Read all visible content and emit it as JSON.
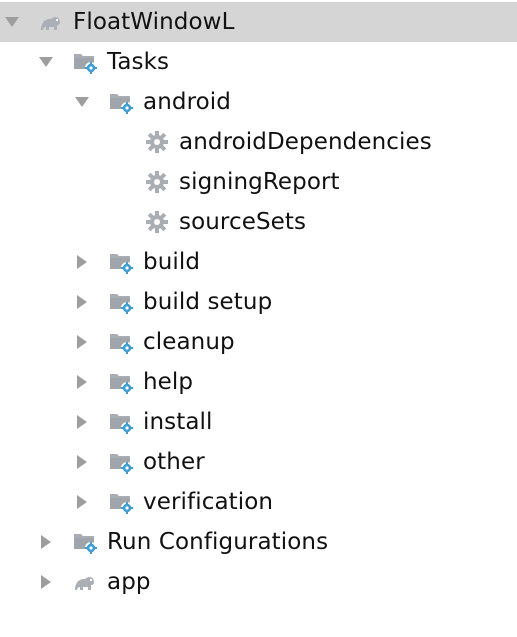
{
  "tree": {
    "root": {
      "label": "FloatWindowL",
      "expanded": true,
      "icon": "gradle-elephant-icon"
    },
    "tasks": {
      "label": "Tasks",
      "expanded": true,
      "icon": "task-folder-icon"
    },
    "android": {
      "label": "android",
      "expanded": true,
      "icon": "task-folder-icon"
    },
    "android_tasks": [
      {
        "label": "androidDependencies",
        "icon": "gear-icon"
      },
      {
        "label": "signingReport",
        "icon": "gear-icon"
      },
      {
        "label": "sourceSets",
        "icon": "gear-icon"
      }
    ],
    "task_groups": [
      {
        "label": "build",
        "expanded": false,
        "icon": "task-folder-icon"
      },
      {
        "label": "build setup",
        "expanded": false,
        "icon": "task-folder-icon"
      },
      {
        "label": "cleanup",
        "expanded": false,
        "icon": "task-folder-icon"
      },
      {
        "label": "help",
        "expanded": false,
        "icon": "task-folder-icon"
      },
      {
        "label": "install",
        "expanded": false,
        "icon": "task-folder-icon"
      },
      {
        "label": "other",
        "expanded": false,
        "icon": "task-folder-icon"
      },
      {
        "label": "verification",
        "expanded": false,
        "icon": "task-folder-icon"
      }
    ],
    "run_configurations": {
      "label": "Run Configurations",
      "expanded": false,
      "icon": "task-folder-icon"
    },
    "app": {
      "label": "app",
      "expanded": false,
      "icon": "gradle-elephant-icon"
    }
  },
  "colors": {
    "selection_bg": "#d5d5d5",
    "arrow": "#9e9e9e",
    "folder": "#a9aeb4",
    "folder_dark": "#8e949b",
    "gear_badge": "#3a9dd8",
    "gear_icon": "#a9aeb4",
    "elephant": "#aab0b6"
  }
}
